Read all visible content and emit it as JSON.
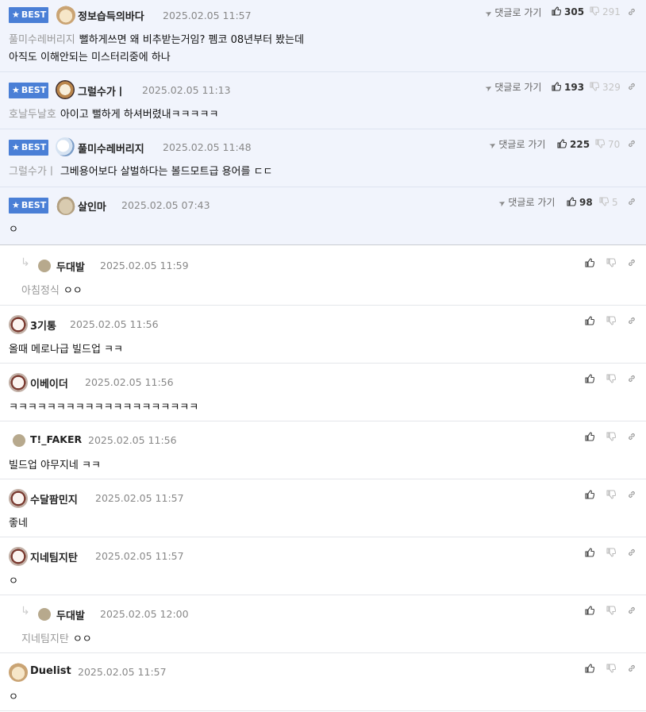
{
  "best_label": "BEST",
  "goto_label": "댓글로 가기",
  "best_comments": [
    {
      "nick": "정보습득의바다",
      "date": "2025.02.05 11:57",
      "mention": "풀미수레버리지",
      "line1": "뻘하게쓰면 왜 비추받는거임? 펨코 08년부터 봤는데",
      "line2": "아직도 이해안되는 미스터리중에 하나",
      "likes": "305",
      "dislikes": "291"
    },
    {
      "nick": "그럴수가ㅣ",
      "date": "2025.02.05 11:13",
      "mention": "호날두날호",
      "line1": "아이고 뻘하게 하셔버렸내ㅋㅋㅋㅋㅋ",
      "likes": "193",
      "dislikes": "329"
    },
    {
      "nick": "풀미수레버리지",
      "date": "2025.02.05 11:48",
      "mention": "그럴수가ㅣ",
      "line1": "그베용어보다 살벌하다는 볼드모트급 용어를 ㄷㄷ",
      "likes": "225",
      "dislikes": "70"
    },
    {
      "nick": "살인마",
      "date": "2025.02.05 07:43",
      "line1": "ㅇ",
      "likes": "98",
      "dislikes": "5"
    }
  ],
  "comments": [
    {
      "nick": "두대발",
      "date": "2025.02.05 11:59",
      "mention": "아침정식",
      "text": "ㅇㅇ",
      "reply": true
    },
    {
      "nick": "3기통",
      "date": "2025.02.05 11:56",
      "text": "올때 메로나급 빌드업 ㅋㅋ"
    },
    {
      "nick": "이베이더",
      "date": "2025.02.05 11:56",
      "text": "ㅋㅋㅋㅋㅋㅋㅋㅋㅋㅋㅋㅋㅋㅋㅋㅋㅋㅋㅋㅋ"
    },
    {
      "nick": "T!_FAKER",
      "date": "2025.02.05 11:56",
      "text": "빌드업 야무지네 ㅋㅋ"
    },
    {
      "nick": "수달팜민지",
      "date": "2025.02.05 11:57",
      "text": "좋네"
    },
    {
      "nick": "지네팀지탄",
      "date": "2025.02.05 11:57",
      "text": "ㅇ"
    },
    {
      "nick": "두대발",
      "date": "2025.02.05 12:00",
      "mention": "지네팀지탄",
      "text": "ㅇㅇ",
      "reply": true
    },
    {
      "nick": "Duelist",
      "date": "2025.02.05 11:57",
      "text": "ㅇ"
    }
  ],
  "icons": {
    "star": "star-icon",
    "goto": "arrow-icon",
    "up": "thumbs-up-icon",
    "down": "thumbs-down-icon",
    "link": "link-icon",
    "reply": "reply-arrow-icon"
  },
  "colors": {
    "best_bg": "#f1f4fc",
    "badge": "#4a7fd6"
  }
}
